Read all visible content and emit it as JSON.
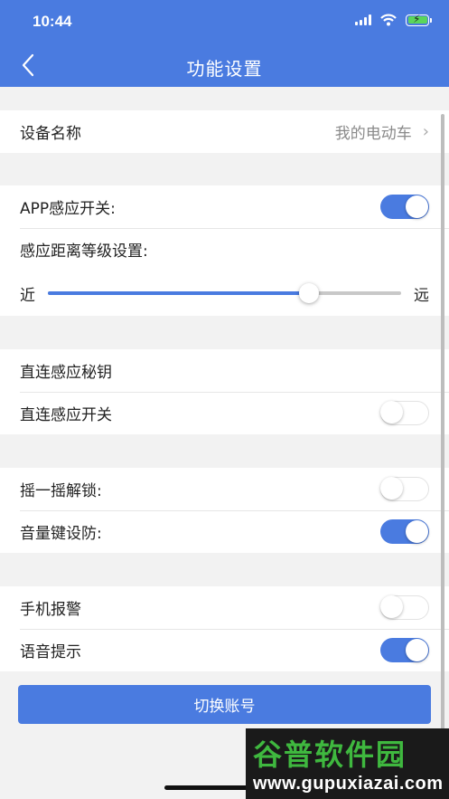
{
  "status": {
    "time": "10:44",
    "wifi_icon": "wifi-icon",
    "battery_icon": "battery-charging-icon"
  },
  "nav": {
    "title": "功能设置",
    "back_icon": "chevron-left-icon"
  },
  "device": {
    "label": "设备名称",
    "value": "我的电动车"
  },
  "sensing": {
    "app_switch_label": "APP感应开关:",
    "app_switch_on": true,
    "distance_label": "感应距离等级设置:",
    "near_label": "近",
    "far_label": "远",
    "distance_level": 0.74
  },
  "direct": {
    "key_label": "直连感应秘钥",
    "switch_label": "直连感应开关",
    "switch_on": false
  },
  "gestures": {
    "shake_label": "摇一摇解锁:",
    "shake_on": false,
    "volume_label": "音量键设防:",
    "volume_on": true
  },
  "alerts": {
    "phone_alarm_label": "手机报警",
    "phone_alarm_on": false,
    "voice_label": "语音提示",
    "voice_on": true
  },
  "switch_account_label": "切换账号",
  "watermark": {
    "brand": "谷普软件园",
    "url": "www.gupuxiazai.com"
  },
  "colors": {
    "accent": "#4a7be0",
    "background": "#f2f2f2"
  }
}
